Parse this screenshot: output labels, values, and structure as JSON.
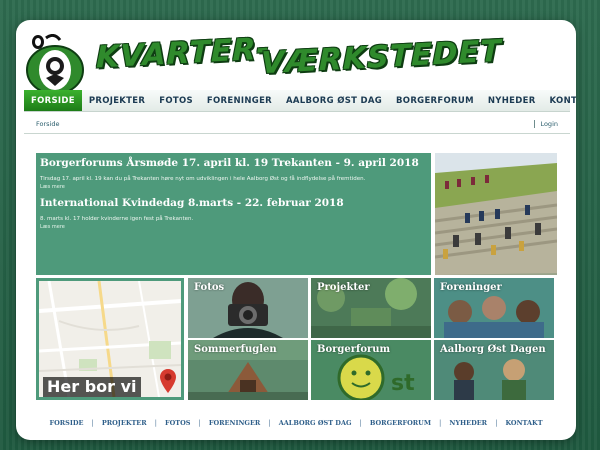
{
  "logo": {
    "line1": "KVARTER-",
    "line2": "VÆRKSTEDET"
  },
  "nav": {
    "items": [
      "FORSIDE",
      "PROJEKTER",
      "FOTOS",
      "FORENINGER",
      "AALBORG ØST DAG",
      "BORGERFORUM",
      "NYHEDER",
      "KONTAKT"
    ],
    "active": "FORSIDE"
  },
  "subbar": {
    "breadcrumb": "Forside",
    "login": "Login"
  },
  "news": [
    {
      "title": "Borgerforums Årsmøde 17. april kl. 19 Trekanten - 9. april 2018",
      "text": "Tirsdag 17. april kl. 19 kan du på Trekanten høre nyt om udviklingen i hele Aalborg Øst og få indflydelse på fremtiden.",
      "more": "Læs mere"
    },
    {
      "title": "International Kvindedag 8.marts - 22. februar 2018",
      "text": "8. marts kl. 17 holder kvinderne igen fest på Trekanten.",
      "more": "Læs mere"
    }
  ],
  "map": {
    "label": "Her bor vi"
  },
  "tiles": [
    "Fotos",
    "Projekter",
    "Foreninger",
    "Sommerfuglen",
    "Borgerforum",
    "Aalborg Øst Dagen"
  ],
  "footer": [
    "FORSIDE",
    "PROJEKTER",
    "FOTOS",
    "FORENINGER",
    "AALBORG ØST DAG",
    "BORGERFORUM",
    "NYHEDER",
    "KONTAKT"
  ],
  "colors": {
    "panel": "#4e9a7b",
    "nav_active": "#2f9a26",
    "link": "#2f5f8a"
  }
}
